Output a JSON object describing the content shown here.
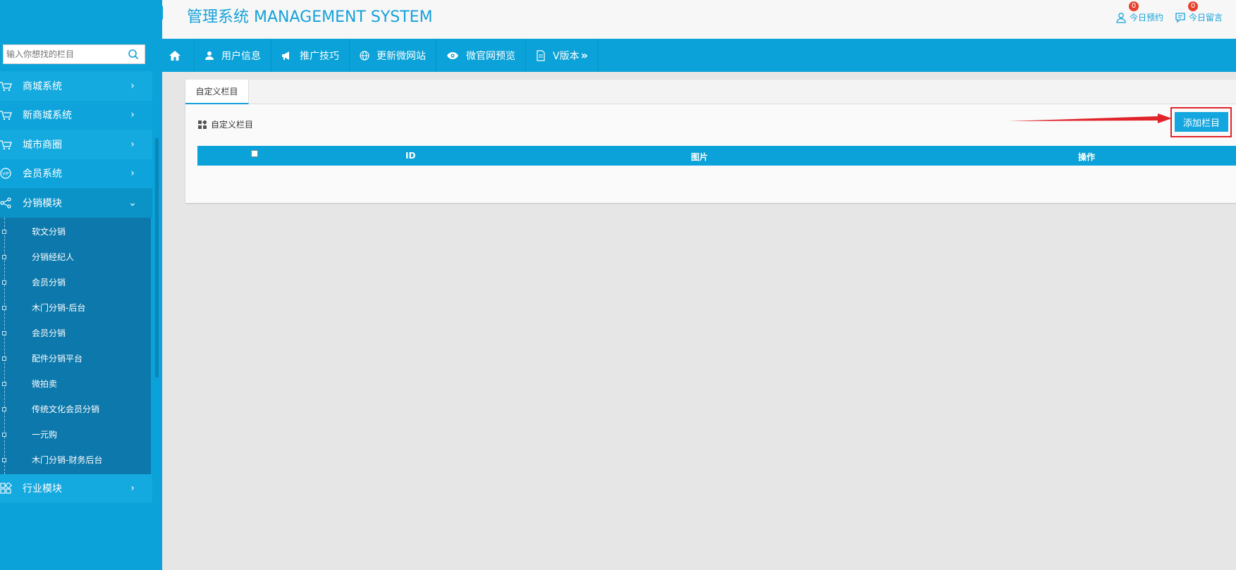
{
  "header": {
    "title": "管理系统 MANAGEMENT SYSTEM",
    "links": [
      {
        "label": "今日预约",
        "badge": "0",
        "icon": "user-icon"
      },
      {
        "label": "今日留言",
        "badge": "0",
        "icon": "message-icon"
      }
    ]
  },
  "sidebar": {
    "search_placeholder": "输入你想找的栏目",
    "items": [
      {
        "label": "商城系统",
        "icon": "cart-icon",
        "chevron": "›"
      },
      {
        "label": "新商城系统",
        "icon": "cart-icon",
        "chevron": "›"
      },
      {
        "label": "城市商圈",
        "icon": "cart-icon",
        "chevron": "›"
      },
      {
        "label": "会员系统",
        "icon": "vip-icon",
        "chevron": "›"
      },
      {
        "label": "分销模块",
        "icon": "share-icon",
        "chevron": "⌄"
      },
      {
        "label": "行业模块",
        "icon": "grid-icon",
        "chevron": "›"
      }
    ],
    "subitems": [
      "软文分销",
      "分销经纪人",
      "会员分销",
      "木门分销-后台",
      "会员分销",
      "配件分销平台",
      "微拍卖",
      "传统文化会员分销",
      "一元购",
      "木门分销-财务后台"
    ]
  },
  "nav": {
    "items": [
      {
        "label": "",
        "icon": "home-icon"
      },
      {
        "label": "用户信息",
        "icon": "user-icon"
      },
      {
        "label": "推广技巧",
        "icon": "megaphone-icon"
      },
      {
        "label": "更新微网站",
        "icon": "globe-icon"
      },
      {
        "label": "微官网预览",
        "icon": "eye-icon"
      },
      {
        "label": "V版本",
        "icon": "document-icon"
      }
    ]
  },
  "panel": {
    "tab_label": "自定义栏目",
    "subtitle": "自定义栏目",
    "add_button": "添加栏目",
    "columns": [
      "ID",
      "图片",
      "操作"
    ]
  },
  "colors": {
    "primary": "#0aa2d8",
    "submenu": "#0c78ab",
    "highlight": "#e0242a",
    "badge": "#e8402c"
  }
}
